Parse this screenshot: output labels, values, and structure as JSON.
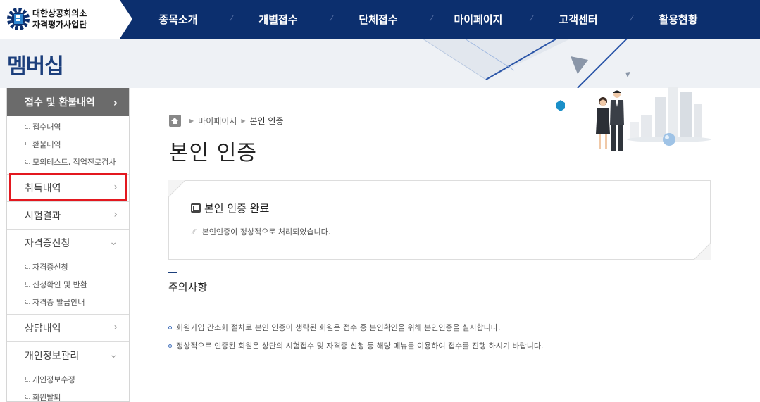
{
  "header": {
    "logo_line1": "대한상공회의소",
    "logo_line2": "자격평가사업단",
    "nav": [
      "종목소개",
      "개별접수",
      "단체접수",
      "마이페이지",
      "고객센터",
      "활용현황"
    ]
  },
  "banner": {
    "title": "멤버십"
  },
  "sidebar": {
    "head": "접수 및 환불내역",
    "head_sub": [
      "접수내역",
      "환불내역",
      "모의테스트, 직업진로검사"
    ],
    "items": [
      {
        "label": "취득내역",
        "sub": []
      },
      {
        "label": "시험결과",
        "sub": []
      },
      {
        "label": "자격증신청",
        "sub": [
          "자격증신청",
          "신청확인 및 반환",
          "자격증 발급안내"
        ]
      },
      {
        "label": "상담내역",
        "sub": []
      },
      {
        "label": "개인정보관리",
        "sub": [
          "개인정보수정",
          "회원탈퇴"
        ]
      }
    ]
  },
  "breadcrumb": {
    "parent": "마이페이지",
    "current": "본인 인증"
  },
  "page_title": "본인 인증",
  "notice": {
    "title": "본인 인증 완료",
    "message": "본인인증이 정상적으로 처리되었습니다."
  },
  "caution": {
    "title": "주의사항",
    "items": [
      "회원가입 간소화 절차로 본인 인증이 생략된 회원은 접수 중 본인확인을 위해 본인인증을 실시합니다.",
      "정상적으로 인증된 회원은 상단의 시험접수 및 자격증 신청 등 해당 메뉴를 이용하여 접수를 진행 하시기 바랍니다."
    ]
  },
  "colors": {
    "navy": "#0c2f6e",
    "highlight": "#e3181f",
    "sidebar_head": "#6b6b6b"
  }
}
